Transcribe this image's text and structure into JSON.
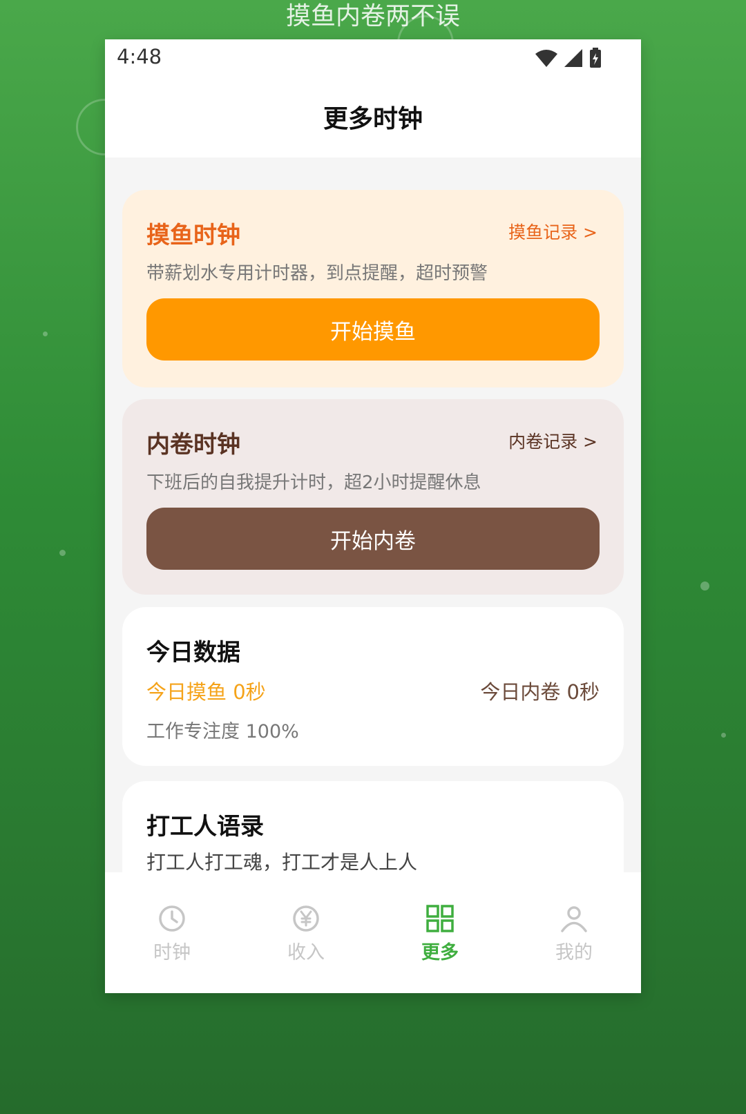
{
  "background": {
    "slogan": "摸鱼内卷两不误"
  },
  "status_bar": {
    "time": "4:48",
    "icons": [
      "wifi-icon",
      "signal-icon",
      "battery-icon"
    ]
  },
  "header": {
    "title": "更多时钟"
  },
  "moyu_card": {
    "title": "摸鱼时钟",
    "link": "摸鱼记录 >",
    "description": "带薪划水专用计时器，到点提醒，超时预警",
    "button": "开始摸鱼",
    "accent_color": "#ff9800"
  },
  "neijuan_card": {
    "title": "内卷时钟",
    "link": "内卷记录 >",
    "description": "下班后的自我提升计时，超2小时提醒休息",
    "button": "开始内卷",
    "accent_color": "#7a5443"
  },
  "today_card": {
    "title": "今日数据",
    "moyu_stat": "今日摸鱼 0秒",
    "neijuan_stat": "今日内卷 0秒",
    "focus": "工作专注度 100%"
  },
  "quote_card": {
    "title": "打工人语录",
    "text": "打工人打工魂，打工才是人上人"
  },
  "tabbar": {
    "active_color": "#3fae3f",
    "items": [
      {
        "label": "时钟",
        "icon": "clock-icon"
      },
      {
        "label": "收入",
        "icon": "yen-icon"
      },
      {
        "label": "更多",
        "icon": "grid-icon"
      },
      {
        "label": "我的",
        "icon": "user-icon"
      }
    ]
  }
}
